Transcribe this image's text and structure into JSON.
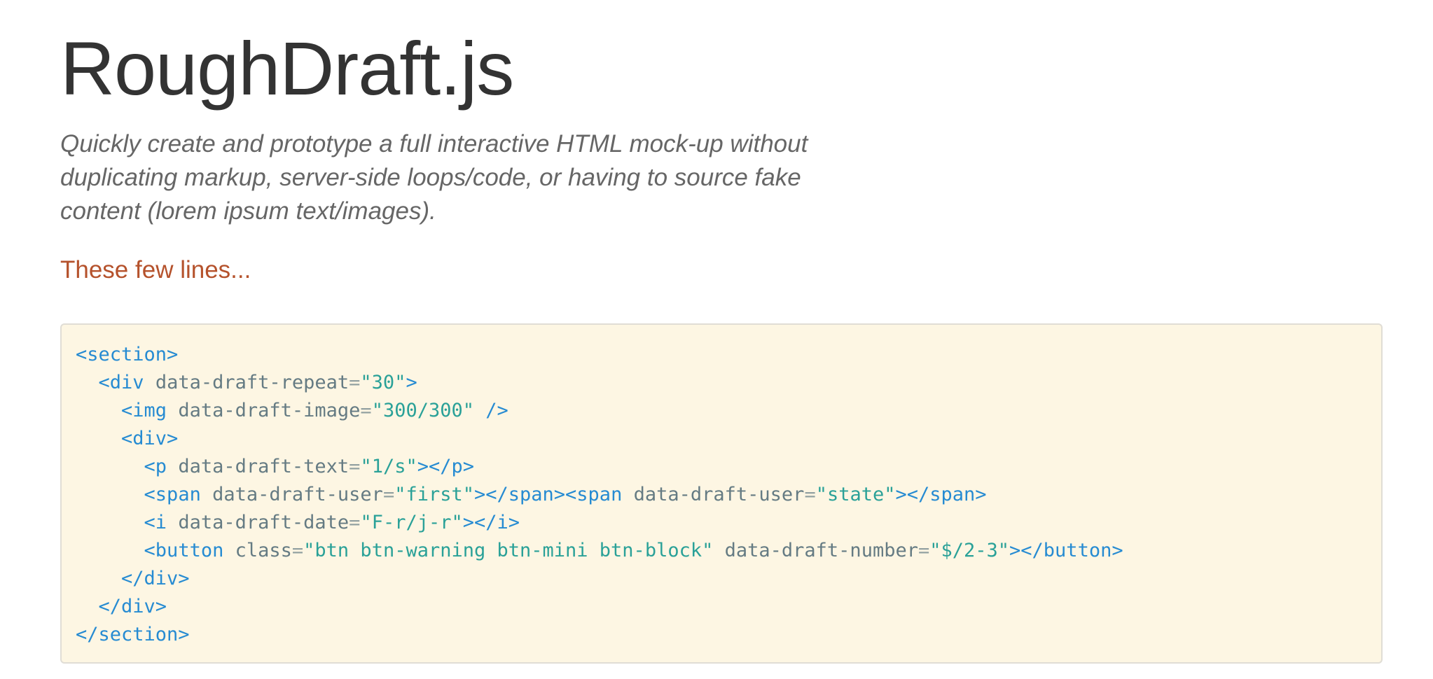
{
  "header": {
    "title": "RoughDraft.js",
    "tagline": "Quickly create and prototype a full interactive HTML mock-up without duplicating markup, server-side loops/code, or having to source fake content (lorem ipsum text/images)."
  },
  "section": {
    "heading": "These few lines..."
  },
  "code": {
    "lines": [
      {
        "indent": "",
        "tokens": [
          {
            "t": "tag",
            "v": "<section>"
          }
        ]
      },
      {
        "indent": "  ",
        "tokens": [
          {
            "t": "tag",
            "v": "<div"
          },
          {
            "t": "sp",
            "v": " "
          },
          {
            "t": "attr",
            "v": "data-draft-repeat"
          },
          {
            "t": "eq",
            "v": "="
          },
          {
            "t": "str",
            "v": "\"30\""
          },
          {
            "t": "tag",
            "v": ">"
          }
        ]
      },
      {
        "indent": "    ",
        "tokens": [
          {
            "t": "tag",
            "v": "<img"
          },
          {
            "t": "sp",
            "v": " "
          },
          {
            "t": "attr",
            "v": "data-draft-image"
          },
          {
            "t": "eq",
            "v": "="
          },
          {
            "t": "str",
            "v": "\"300/300\""
          },
          {
            "t": "sp",
            "v": " "
          },
          {
            "t": "tag",
            "v": "/>"
          }
        ]
      },
      {
        "indent": "    ",
        "tokens": [
          {
            "t": "tag",
            "v": "<div>"
          }
        ]
      },
      {
        "indent": "      ",
        "tokens": [
          {
            "t": "tag",
            "v": "<p"
          },
          {
            "t": "sp",
            "v": " "
          },
          {
            "t": "attr",
            "v": "data-draft-text"
          },
          {
            "t": "eq",
            "v": "="
          },
          {
            "t": "str",
            "v": "\"1/s\""
          },
          {
            "t": "tag",
            "v": "></p>"
          }
        ]
      },
      {
        "indent": "      ",
        "tokens": [
          {
            "t": "tag",
            "v": "<span"
          },
          {
            "t": "sp",
            "v": " "
          },
          {
            "t": "attr",
            "v": "data-draft-user"
          },
          {
            "t": "eq",
            "v": "="
          },
          {
            "t": "str",
            "v": "\"first\""
          },
          {
            "t": "tag",
            "v": "></span><span"
          },
          {
            "t": "sp",
            "v": " "
          },
          {
            "t": "attr",
            "v": "data-draft-user"
          },
          {
            "t": "eq",
            "v": "="
          },
          {
            "t": "str",
            "v": "\"state\""
          },
          {
            "t": "tag",
            "v": "></span>"
          }
        ]
      },
      {
        "indent": "      ",
        "tokens": [
          {
            "t": "tag",
            "v": "<i"
          },
          {
            "t": "sp",
            "v": " "
          },
          {
            "t": "attr",
            "v": "data-draft-date"
          },
          {
            "t": "eq",
            "v": "="
          },
          {
            "t": "str",
            "v": "\"F-r/j-r\""
          },
          {
            "t": "tag",
            "v": "></i>"
          }
        ]
      },
      {
        "indent": "      ",
        "tokens": [
          {
            "t": "tag",
            "v": "<button"
          },
          {
            "t": "sp",
            "v": " "
          },
          {
            "t": "attr",
            "v": "class"
          },
          {
            "t": "eq",
            "v": "="
          },
          {
            "t": "str",
            "v": "\"btn btn-warning btn-mini btn-block\""
          },
          {
            "t": "sp",
            "v": " "
          },
          {
            "t": "attr",
            "v": "data-draft-number"
          },
          {
            "t": "eq",
            "v": "="
          },
          {
            "t": "str",
            "v": "\"$/2-3\""
          },
          {
            "t": "tag",
            "v": "></button>"
          }
        ]
      },
      {
        "indent": "    ",
        "tokens": [
          {
            "t": "tag",
            "v": "</div>"
          }
        ]
      },
      {
        "indent": "  ",
        "tokens": [
          {
            "t": "tag",
            "v": "</div>"
          }
        ]
      },
      {
        "indent": "",
        "tokens": [
          {
            "t": "tag",
            "v": "</section>"
          }
        ]
      }
    ]
  },
  "colors": {
    "title": "#333333",
    "tagline": "#666666",
    "heading_accent": "#b5522c",
    "code_background": "#fdf6e3",
    "code_tag": "#268bd2",
    "code_attr": "#657b83",
    "code_string": "#2aa198"
  }
}
